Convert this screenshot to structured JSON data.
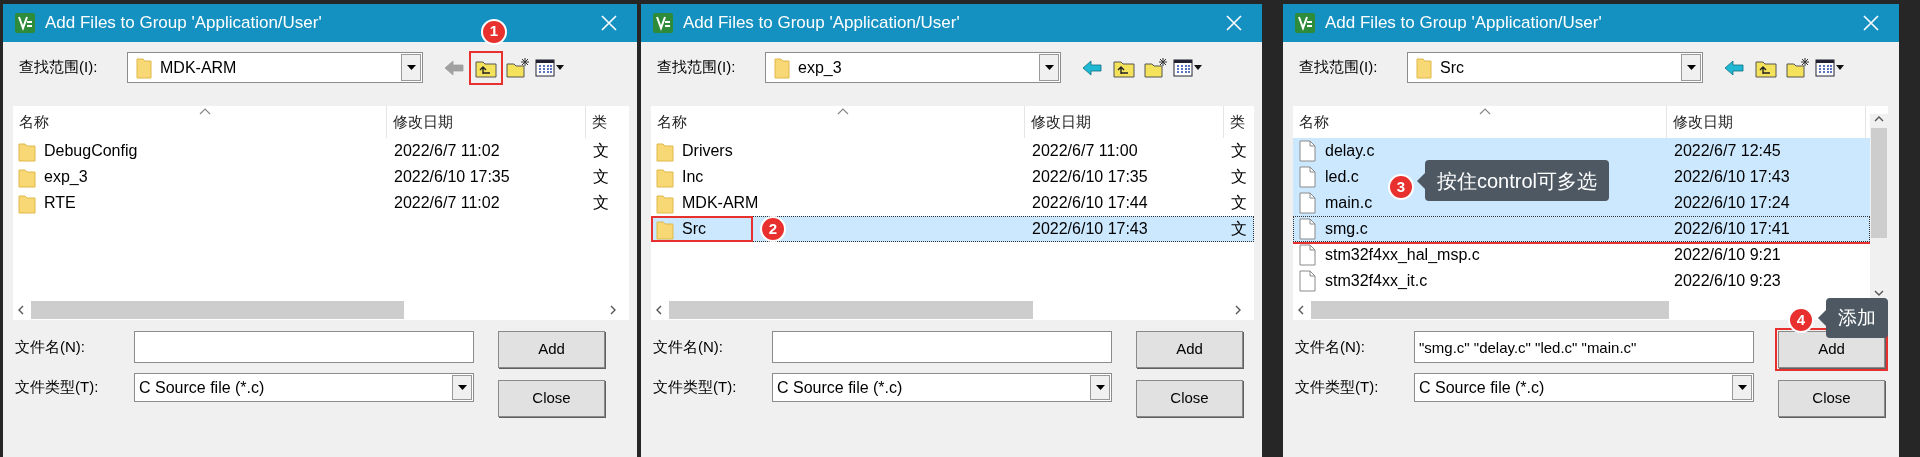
{
  "dialogs": [
    {
      "title": "Add Files to Group 'Application/User'",
      "look_in": {
        "label": "查找范围(I):",
        "value": "MDK-ARM"
      },
      "toolbar": [
        {
          "kind": "back",
          "disabled": true
        },
        {
          "kind": "up",
          "marker": "1"
        },
        {
          "kind": "new-folder"
        },
        {
          "kind": "view-menu"
        }
      ],
      "columns": [
        {
          "label": "名称"
        },
        {
          "label": "修改日期"
        },
        {
          "label": "类"
        }
      ],
      "rows": [
        {
          "kind": "folder",
          "name": "DebugConfig",
          "date": "2022/6/7 11:02",
          "type": "文",
          "selected": false,
          "focused": false
        },
        {
          "kind": "folder",
          "name": "exp_3",
          "date": "2022/6/10 17:35",
          "type": "文",
          "selected": false,
          "focused": false
        },
        {
          "kind": "folder",
          "name": "RTE",
          "date": "2022/6/7 11:02",
          "type": "文",
          "selected": false,
          "focused": false
        }
      ],
      "scrollable": false,
      "file_name": {
        "label": "文件名(N):"
      },
      "file_type": {
        "label": "文件类型(T):",
        "value": "C Source file (*.c)"
      },
      "buttons": [
        {
          "label": "Add"
        },
        {
          "label": "Close"
        }
      ]
    },
    {
      "title": "Add Files to Group 'Application/User'",
      "look_in": {
        "label": "查找范围(I):",
        "value": "exp_3"
      },
      "toolbar": [
        {
          "kind": "back",
          "disabled": false
        },
        {
          "kind": "up"
        },
        {
          "kind": "new-folder"
        },
        {
          "kind": "view-menu"
        }
      ],
      "columns": [
        {
          "label": "名称"
        },
        {
          "label": "修改日期"
        },
        {
          "label": "类"
        }
      ],
      "rows": [
        {
          "kind": "folder",
          "name": "Drivers",
          "date": "2022/6/7 11:00",
          "type": "文",
          "selected": false,
          "focused": false
        },
        {
          "kind": "folder",
          "name": "Inc",
          "date": "2022/6/10 17:35",
          "type": "文",
          "selected": false,
          "focused": false
        },
        {
          "kind": "folder",
          "name": "MDK-ARM",
          "date": "2022/6/10 17:44",
          "type": "文",
          "selected": false,
          "focused": false
        },
        {
          "kind": "folder",
          "name": "Src",
          "date": "2022/6/10 17:43",
          "type": "文",
          "selected": true,
          "focused": true,
          "marker": "2"
        }
      ],
      "scrollable": false,
      "file_name": {
        "label": "文件名(N):"
      },
      "file_type": {
        "label": "文件类型(T):",
        "value": "C Source file (*.c)"
      },
      "buttons": [
        {
          "label": "Add"
        },
        {
          "label": "Close"
        }
      ]
    },
    {
      "title": "Add Files to Group 'Application/User'",
      "look_in": {
        "label": "查找范围(I):",
        "value": "Src"
      },
      "toolbar": [
        {
          "kind": "back",
          "disabled": false
        },
        {
          "kind": "up"
        },
        {
          "kind": "new-folder"
        },
        {
          "kind": "view-menu"
        }
      ],
      "columns": [
        {
          "label": "名称"
        },
        {
          "label": "修改日期"
        }
      ],
      "rows": [
        {
          "kind": "file",
          "name": "delay.c",
          "date": "2022/6/7 12:45",
          "selected": true,
          "focused": false,
          "in_box": true
        },
        {
          "kind": "file",
          "name": "led.c",
          "date": "2022/6/10 17:43",
          "selected": true,
          "focused": false,
          "in_box": true
        },
        {
          "kind": "file",
          "name": "main.c",
          "date": "2022/6/10 17:24",
          "selected": true,
          "focused": false,
          "in_box": true
        },
        {
          "kind": "file",
          "name": "smg.c",
          "date": "2022/6/10 17:41",
          "selected": true,
          "focused": true,
          "in_box": true
        },
        {
          "kind": "file",
          "name": "stm32f4xx_hal_msp.c",
          "date": "2022/6/10 9:21",
          "selected": false,
          "focused": false
        },
        {
          "kind": "file",
          "name": "stm32f4xx_it.c",
          "date": "2022/6/10 9:23",
          "selected": false,
          "focused": false
        }
      ],
      "box_note": {
        "marker": "3",
        "callout": "按住control可多选"
      },
      "scrollable": true,
      "file_name": {
        "label": "文件名(N):",
        "value": "\"smg.c\" \"delay.c\" \"led.c\" \"main.c\""
      },
      "file_type": {
        "label": "文件类型(T):",
        "value": "C Source file (*.c)"
      },
      "buttons": [
        {
          "label": "Add",
          "marker": "4",
          "callout": "添加"
        },
        {
          "label": "Close"
        }
      ]
    }
  ]
}
